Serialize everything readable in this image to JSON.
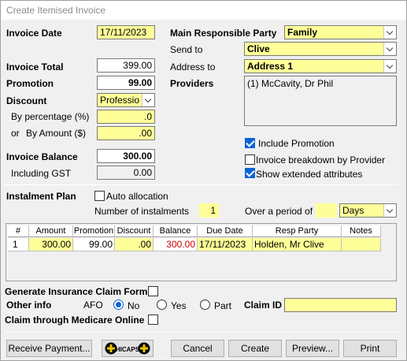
{
  "window": {
    "title": "Create Itemised Invoice"
  },
  "invoice_date": {
    "label": "Invoice Date",
    "value": "17/11/2023"
  },
  "invoice_total": {
    "label": "Invoice Total",
    "value": "399.00"
  },
  "promotion": {
    "label": "Promotion",
    "value": "99.00"
  },
  "discount": {
    "label": "Discount",
    "value": "Professio"
  },
  "by_percentage": {
    "label": "By percentage (%)",
    "value": ".0"
  },
  "by_amount": {
    "or_label": "or",
    "label": "By Amount ($)",
    "value": ".00"
  },
  "invoice_balance": {
    "label": "Invoice Balance",
    "value": "300.00"
  },
  "including_gst": {
    "label": "Including GST",
    "value": "0.00"
  },
  "main_party": {
    "label": "Main Responsible Party",
    "value": "Family"
  },
  "send_to": {
    "label": "Send to",
    "value": "Clive"
  },
  "address_to": {
    "label": "Address to",
    "value": "Address 1"
  },
  "providers": {
    "label": "Providers",
    "items": [
      "(1) McCavity, Dr Phil"
    ]
  },
  "options": {
    "include_promotion": {
      "label": "Include Promotion",
      "checked": true
    },
    "breakdown_by_provider": {
      "label": "Invoice breakdown by Provider",
      "checked": false
    },
    "show_extended": {
      "label": "Show extended attributes",
      "checked": true
    }
  },
  "instalment": {
    "label": "Instalment Plan",
    "auto_allocation": {
      "label": "Auto allocation",
      "checked": false
    },
    "number_label": "Number of instalments",
    "number_value": "1",
    "period_label": "Over a period of",
    "period_value": "",
    "period_unit": "Days"
  },
  "table": {
    "headers": [
      "#",
      "Amount",
      "Promotion",
      "Discount",
      "Balance",
      "Due Date",
      "Resp Party",
      "Notes"
    ],
    "rows": [
      [
        "1",
        "300.00",
        "99.00",
        ".00",
        "300.00",
        "17/11/2023",
        "Holden, Mr Clive",
        ""
      ]
    ]
  },
  "claim": {
    "generate_label": "Generate Insurance Claim Form",
    "other_info_label": "Other info",
    "afo_label": "AFO",
    "radio_no": "No",
    "radio_yes": "Yes",
    "radio_part": "Part",
    "claim_id_label": "Claim ID",
    "claim_id_value": "",
    "medicare_label": "Claim through Medicare Online"
  },
  "buttons": {
    "receive_payment": "Receive  Payment...",
    "hicaps": "HICAPS",
    "cancel": "Cancel",
    "create": "Create",
    "preview": "Preview...",
    "print": "Print"
  },
  "colors": {
    "required_field": "#ffff99",
    "balance_red": "#cc0000",
    "accent": "#0a64d6"
  }
}
